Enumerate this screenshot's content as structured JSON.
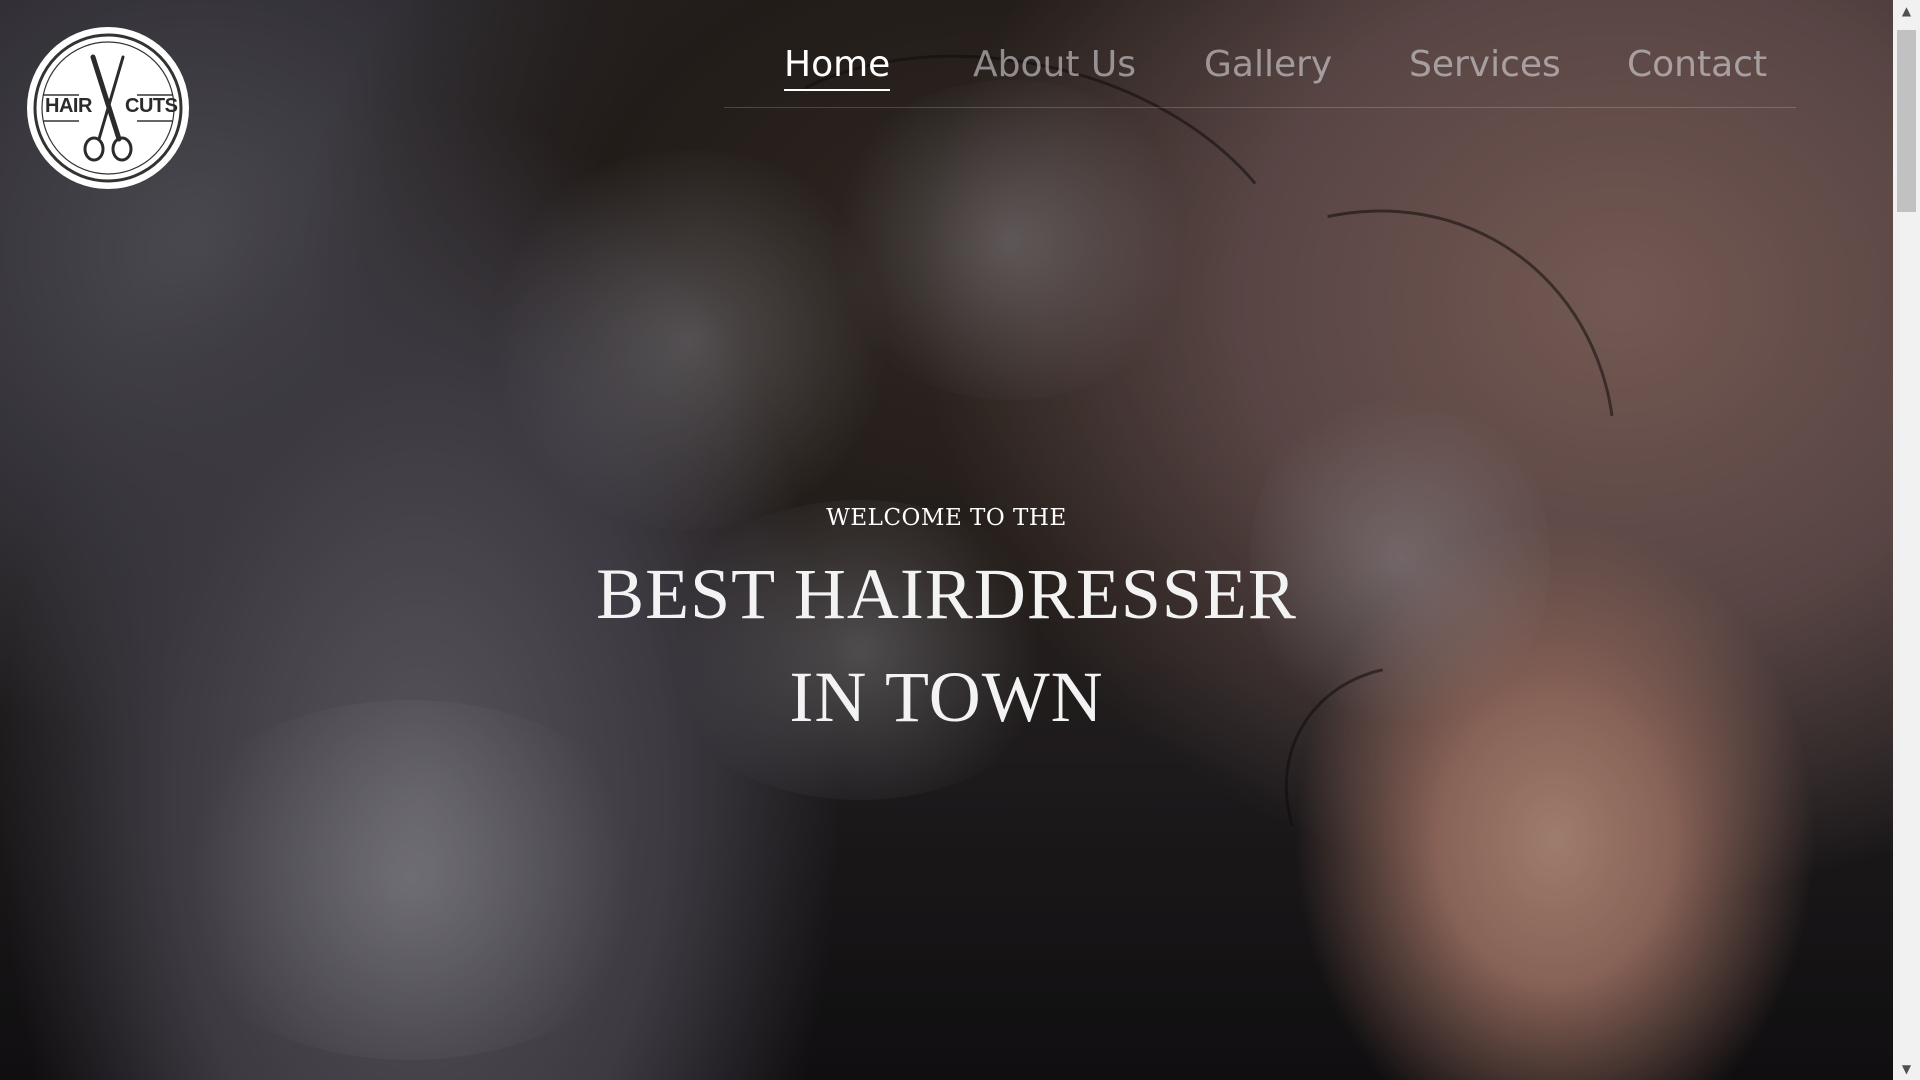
{
  "logo": {
    "text_left": "HAIR",
    "text_right": "CUTS",
    "icon": "scissors-icon"
  },
  "nav": {
    "items": [
      {
        "label": "Home",
        "active": true
      },
      {
        "label": "About Us",
        "active": false
      },
      {
        "label": "Gallery",
        "active": false
      },
      {
        "label": "Services",
        "active": false
      },
      {
        "label": "Contact",
        "active": false
      }
    ]
  },
  "hero": {
    "welcome": "WELCOME TO THE",
    "headline_line1": "BEST HAIRDRESSER",
    "headline_line2": "IN TOWN"
  },
  "scrollbar": {
    "up_icon": "arrow-up-icon",
    "down_icon": "arrow-down-icon"
  },
  "colors": {
    "nav_active": "#ffffff",
    "nav_inactive": "rgba(230,230,235,0.55)",
    "headline": "#f3f3f3"
  }
}
